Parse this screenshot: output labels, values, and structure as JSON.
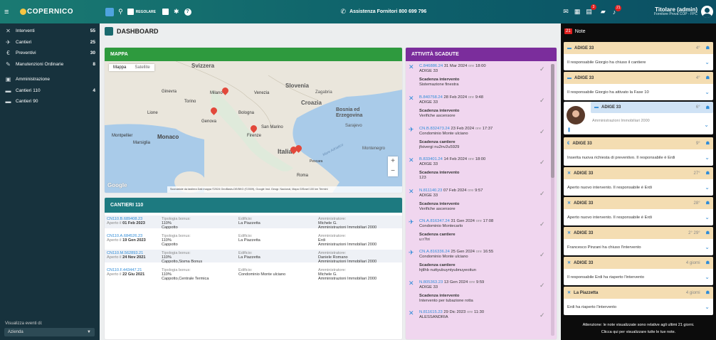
{
  "header": {
    "brand": "COPERNICO",
    "regolare": "REGOLARE",
    "assistenza": "Assistenza Fornitori 800 699 796",
    "badge1": "3",
    "badge2": "21",
    "user_name": "Titolare (admin)",
    "user_sub": "Fornitore Prova COP - FPC"
  },
  "sidebar": {
    "items": [
      {
        "icon": "✕",
        "label": "Interventi",
        "count": "55"
      },
      {
        "icon": "✈",
        "label": "Cantieri",
        "count": "25"
      },
      {
        "icon": "€",
        "label": "Preventivi",
        "count": "30"
      },
      {
        "icon": "✎",
        "label": "Manutenzioni Ordinarie",
        "count": "8"
      },
      {
        "icon": "",
        "label": "",
        "count": ""
      },
      {
        "icon": "▣",
        "label": "Amministrazione",
        "count": ""
      },
      {
        "icon": "▬",
        "label": "Cantieri 110",
        "count": "4"
      },
      {
        "icon": "▬",
        "label": "Cantieri 90",
        "count": ""
      }
    ],
    "filter_label": "Visualizza eventi di:",
    "filter_value": "Azienda"
  },
  "main": {
    "title": "DASHBOARD"
  },
  "map": {
    "title": "MAPPA",
    "tab_map": "Mappa",
    "tab_sat": "Satellite",
    "attribution": "Scorciatoie da tastiera  Dati mappa ©2024 GeoBasis-DE/BKG (©2009), Google Inst. Geogr. Nacional, Mapa GISrael  100 km  Termini",
    "google": "Google",
    "places": [
      {
        "name": "Svizzera"
      },
      {
        "name": "Slovenia"
      },
      {
        "name": "Zagabria"
      },
      {
        "name": "Croazia"
      },
      {
        "name": "Bosnia ed Erzegovina"
      },
      {
        "name": "Sarajevo"
      },
      {
        "name": "Montenegro"
      },
      {
        "name": "Milano"
      },
      {
        "name": "Venezia"
      },
      {
        "name": "Torino"
      },
      {
        "name": "Genova"
      },
      {
        "name": "Bologna"
      },
      {
        "name": "San Marino"
      },
      {
        "name": "Firenze"
      },
      {
        "name": "Monaco"
      },
      {
        "name": "Marsiglia"
      },
      {
        "name": "Montpellier"
      },
      {
        "name": "Italia"
      },
      {
        "name": "Roma"
      },
      {
        "name": "Pescara"
      },
      {
        "name": "Ginevra"
      },
      {
        "name": "Lione"
      },
      {
        "name": "Mare Adriatico"
      }
    ]
  },
  "cantieri": {
    "title": "CANTIERI 110",
    "rows": [
      {
        "code": "CN110.B.689408.23",
        "opened": "Aperto il",
        "date": "01 Feb 2023",
        "bonus_label": "Tipologia bonus:",
        "bonus": "110%",
        "bonus_detail": "Cappotto",
        "building_label": "Edificio:",
        "building": "La Piazzetta",
        "admin_label": "Amministratore:",
        "admin": "Michele G.",
        "admin2": "Amministrazioni Immobiliari 2000"
      },
      {
        "code": "CN110.A.684526.23",
        "opened": "Aperto il",
        "date": "19 Gen 2023",
        "bonus_label": "Tipologia bonus:",
        "bonus": "110%",
        "bonus_detail": "Cappotto",
        "building_label": "Edificio:",
        "building": "La Piazzetta",
        "admin_label": "Amministratore:",
        "admin": "Erdi",
        "admin2": "Amministrazioni Immobiliari 2000"
      },
      {
        "code": "CN110.M.562893.21",
        "opened": "Aperto il",
        "date": "24 Nov 2021",
        "bonus_label": "Tipologia bonus:",
        "bonus": "110%",
        "bonus_detail": "Cappotto,Sisma Bonus",
        "building_label": "Edificio:",
        "building": "La Piazzetta",
        "admin_label": "Amministratore:",
        "admin": "Daniele Romano",
        "admin2": "Amministrazioni Immobiliari 2000"
      },
      {
        "code": "CN110.F.443447.21",
        "opened": "Aperto il",
        "date": "22 Giu 2021",
        "bonus_label": "Tipologia bonus:",
        "bonus": "110%",
        "bonus_detail": "Cappotto,Centrale Termica",
        "building_label": "Edificio:",
        "building": "Condominio Monte ulciano",
        "admin_label": "Amministratore:",
        "admin": "Michele G.",
        "admin2": "Amministrazioni Immobiliari 2000"
      }
    ]
  },
  "attivita": {
    "title": "ATTIVITÀ SCADUTE",
    "items": [
      {
        "icon": "✕",
        "code": "C.846886.24",
        "date": "31 Mar 2024",
        "ore": "ore",
        "time": "18:00",
        "place": "ADIGE 33",
        "kind": "Scadenza intervento",
        "detail": "Sistemazione finestra"
      },
      {
        "icon": "✕",
        "code": "B.840758.24",
        "date": "28 Feb 2024",
        "ore": "ore",
        "time": "9:48",
        "place": "ADIGE 33",
        "kind": "Scadenza intervento",
        "detail": "Verifiche ascensore"
      },
      {
        "icon": "✈",
        "code": "CN.B.832473.24",
        "date": "23 Feb 2024",
        "ore": "ore",
        "time": "17:37",
        "place": "Condominio Monte ulciano",
        "kind": "Scadenza cantiere",
        "detail": "jfsivergi nu2nv2u5929"
      },
      {
        "icon": "✕",
        "code": "B.833401.24",
        "date": "14 Feb 2024",
        "ore": "ore",
        "time": "18:00",
        "place": "ADIGE 33",
        "kind": "Scadenza intervento",
        "detail": "123"
      },
      {
        "icon": "✕",
        "code": "N.811140.23",
        "date": "07 Feb 2024",
        "ore": "ore",
        "time": "9:57",
        "place": "ADIGE 33",
        "kind": "Scadenza intervento",
        "detail": "Verifiche ascensore"
      },
      {
        "icon": "✈",
        "code": "CN.A.816347.24",
        "date": "31 Gen 2024",
        "ore": "ore",
        "time": "17:08",
        "place": "Condominio Montecarlo",
        "kind": "Scadenza cantiere",
        "detail": "u:r7tri"
      },
      {
        "icon": "✈",
        "code": "CN.A.816336.24",
        "date": "25 Gen 2024",
        "ore": "ore",
        "time": "16:55",
        "place": "Condominio Monte ulciano",
        "kind": "Scadenza cantiere",
        "detail": "hjtlhb nuttyubuyntyubnuyeoitun"
      },
      {
        "icon": "✕",
        "code": "N.805363.23",
        "date": "13 Gen 2024",
        "ore": "ore",
        "time": "9:59",
        "place": "ADIGE 33",
        "kind": "Scadenza intervento",
        "detail": "Intervento per tubazione rotta"
      },
      {
        "icon": "✕",
        "code": "N.811615.23",
        "date": "29 Dic 2023",
        "ore": "ore",
        "time": "11:30",
        "place": "ALESSANDRIA",
        "kind": "",
        "detail": ""
      }
    ]
  },
  "notes": {
    "count": "21",
    "title": "Note",
    "footer1": "Attenzione: le note visualizzate sono relative agli ultimi 21 giorni.",
    "footer2": "Clicca qui per visualizzare tutte le tue note.",
    "items": [
      {
        "icon": "▬",
        "title": "ADIGE 33",
        "time": "4°",
        "text": "Il responsabile Giorgio ha chiuso il cantiere"
      },
      {
        "icon": "▬",
        "title": "ADIGE 33",
        "time": "4°",
        "text": "Il responsabile Giorgio ha attivato la Fase 10"
      },
      {
        "icon": "▬",
        "title": "ADIGE 33",
        "time": "6°",
        "text": "Amministrazioni Immobiliari 2000"
      },
      {
        "icon": "€",
        "title": "ADIGE 33",
        "time": "9°",
        "text": "Inserita nuova richiesta di preventivo. Il responsabile è Erdi"
      },
      {
        "icon": "✕",
        "title": "ADIGE 33",
        "time": "27°",
        "text": "Aperto nuovo intervento. Il responsabile è Erdi"
      },
      {
        "icon": "✕",
        "title": "ADIGE 33",
        "time": "28°",
        "text": "Aperto nuovo intervento. Il responsabile è Erdi"
      },
      {
        "icon": "✕",
        "title": "ADIGE 33",
        "time": "2° 29°",
        "text": "Francesco Pinzani ha chiuso l'intervento"
      },
      {
        "icon": "✕",
        "title": "ADIGE 33",
        "time": "4 giorni",
        "text": "Il responsabile Erdi ha riaperto l'intervento"
      },
      {
        "icon": "✕",
        "title": "La Piazzetta",
        "time": "4 giorni",
        "text": "Erdi ha riaperto l'intervento"
      }
    ]
  }
}
